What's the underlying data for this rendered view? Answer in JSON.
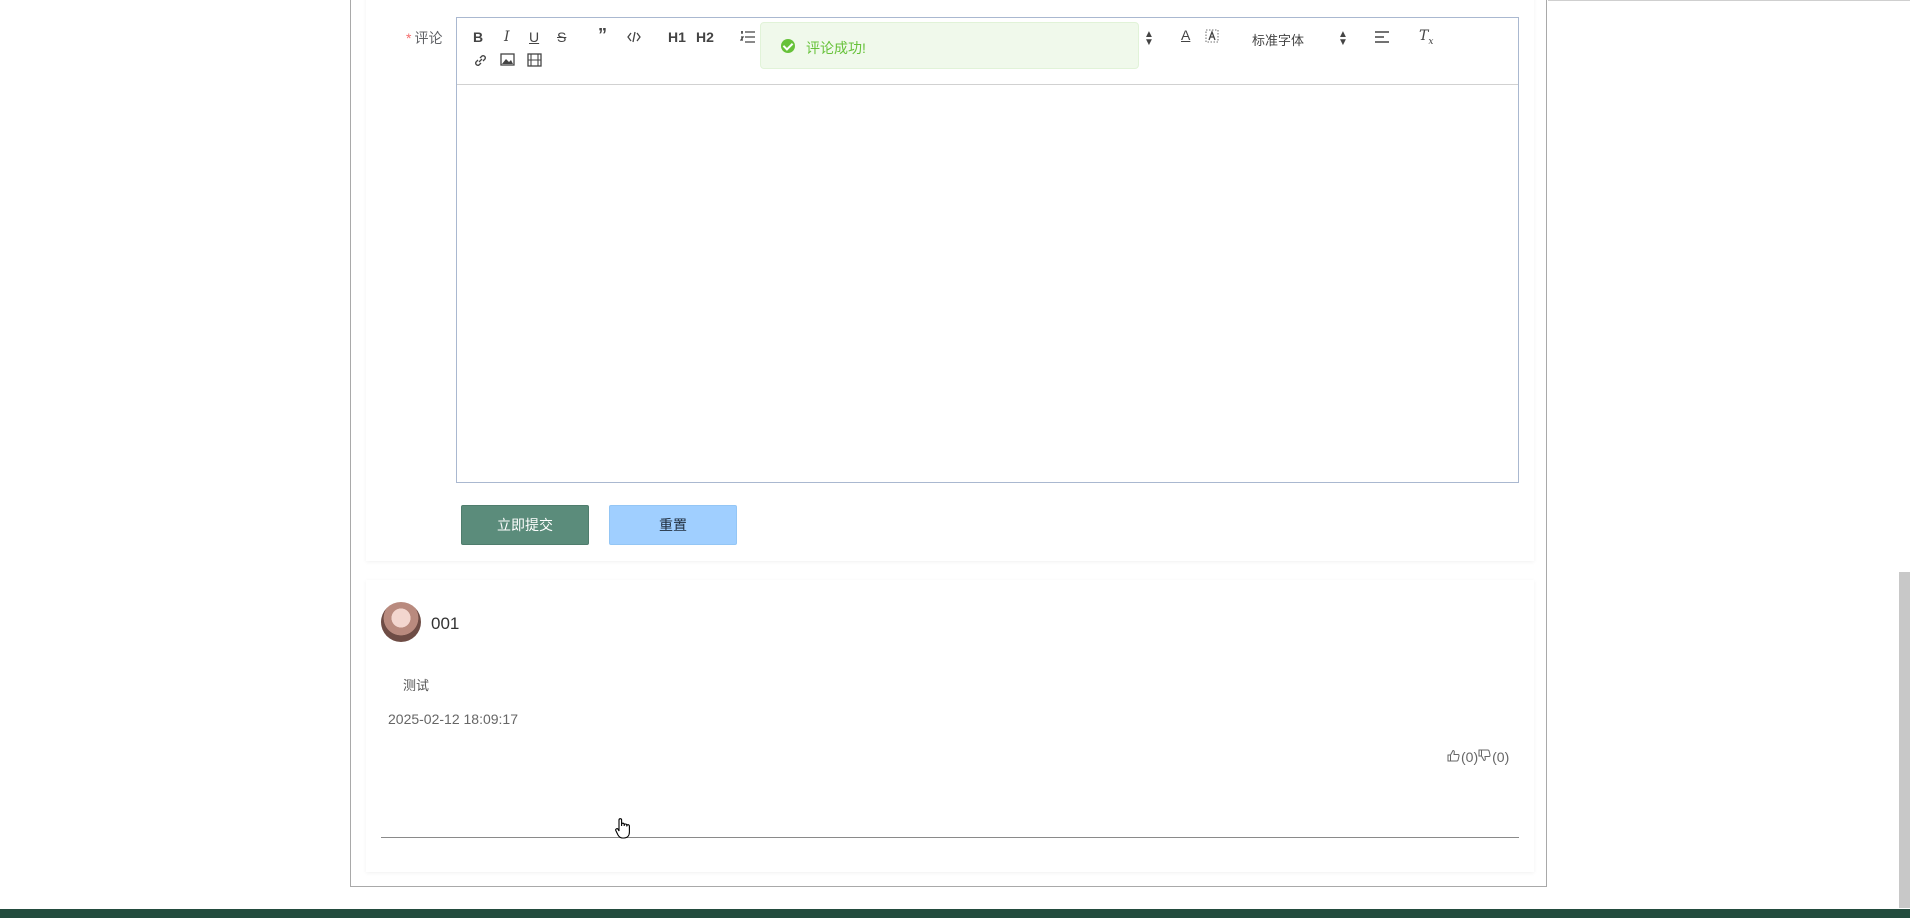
{
  "form": {
    "comment_label": "评论",
    "required_mark": "*",
    "editor": {
      "toolbar": [
        "bold-icon",
        "italic-icon",
        "underline-icon",
        "strike-icon",
        "blockquote-icon",
        "code-block-icon",
        "h1-icon",
        "h2-icon",
        "ordered-list-icon",
        "color-icon",
        "background-icon",
        "font-select",
        "align-icon",
        "clean-icon",
        "link-icon",
        "image-icon",
        "video-icon"
      ],
      "h1_label": "H1",
      "h2_label": "H2",
      "font_select_value": "标准字体"
    },
    "submit_label": "立即提交",
    "reset_label": "重置"
  },
  "toast": {
    "message": "评论成功!",
    "color": "#67c23a"
  },
  "comment": {
    "username": "001",
    "text": "测试",
    "time": "2025-02-12 18:09:17",
    "likes": "(0)",
    "dislikes": "(0)"
  },
  "colors": {
    "submit": "#5b8c7b",
    "reset": "#a0cfff",
    "footer": "#234c3e"
  }
}
